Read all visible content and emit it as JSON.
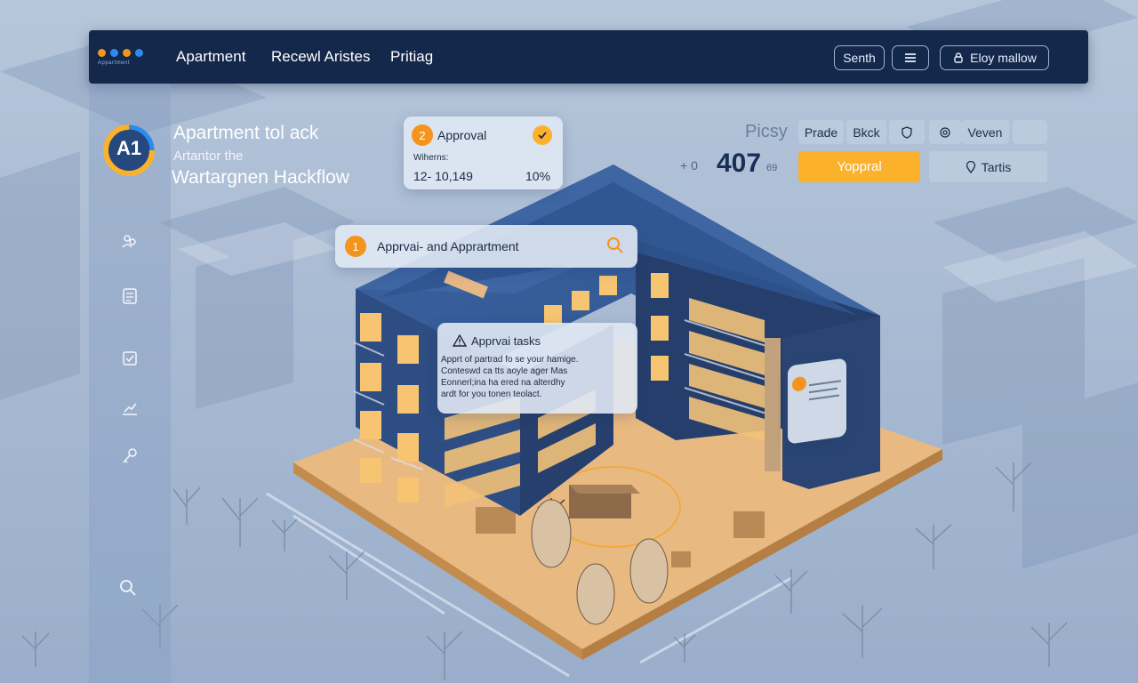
{
  "brand": {
    "logo_text": "Appartment",
    "dot_colors": [
      "#f4941c",
      "#2c8bf0",
      "#f4941c",
      "#2c8bf0"
    ]
  },
  "nav": {
    "items": [
      "Apartment",
      "Recewl Aristes",
      "Pritiag"
    ]
  },
  "header": {
    "search_label": "Senth",
    "menu_icon": "menu-icon",
    "user_button_label": "Eloy mallow",
    "user_icon": "lock-icon"
  },
  "sidebar": {
    "icons": [
      "people-icon",
      "document-icon",
      "checklist-icon",
      "chart-icon",
      "key-icon",
      "search-icon"
    ]
  },
  "hero": {
    "badge": "A1",
    "title": "Apartment tol ack",
    "subtitle": "Artantor the",
    "heading": "Wartargnen Hackflow"
  },
  "approval_card": {
    "number": "2",
    "title": "Approval",
    "meta_label": "Wiherns:",
    "range": "12- 10,149",
    "percent": "10%"
  },
  "search_card": {
    "number": "1",
    "label": "Apprvai- and Apprartment"
  },
  "tasks_card": {
    "title": "Apprvai tasks",
    "lines": [
      "Apprt of partrad fo se your hamige.",
      "Conteswd ca tts aoyle ager Mas",
      "Eonnerl;ina ha ered na alterdhy",
      "ardt for you tonen teolact."
    ]
  },
  "right_panel": {
    "label": "Picsy",
    "prefix": "+ 0",
    "value": "407",
    "value_suffix": "69",
    "buttons": [
      "Prade",
      "Bkck",
      "Veven"
    ],
    "primary_button": "Yoppral",
    "secondary_button": "Tartis"
  },
  "colors": {
    "accent": "#f4941c",
    "primary": "#fbb12b",
    "navy": "#13284a",
    "building": "#2c4b7c"
  }
}
